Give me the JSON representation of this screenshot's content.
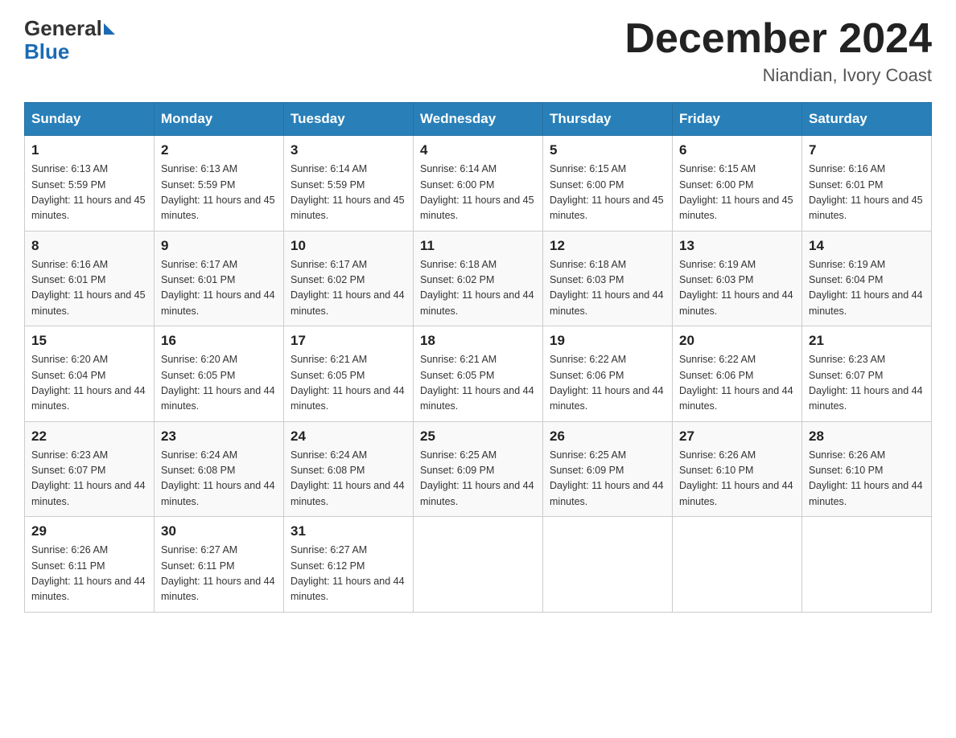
{
  "header": {
    "logo_general": "General",
    "logo_blue": "Blue",
    "month_title": "December 2024",
    "location": "Niandian, Ivory Coast"
  },
  "weekdays": [
    "Sunday",
    "Monday",
    "Tuesday",
    "Wednesday",
    "Thursday",
    "Friday",
    "Saturday"
  ],
  "weeks": [
    [
      {
        "day": "1",
        "sunrise": "6:13 AM",
        "sunset": "5:59 PM",
        "daylight": "11 hours and 45 minutes."
      },
      {
        "day": "2",
        "sunrise": "6:13 AM",
        "sunset": "5:59 PM",
        "daylight": "11 hours and 45 minutes."
      },
      {
        "day": "3",
        "sunrise": "6:14 AM",
        "sunset": "5:59 PM",
        "daylight": "11 hours and 45 minutes."
      },
      {
        "day": "4",
        "sunrise": "6:14 AM",
        "sunset": "6:00 PM",
        "daylight": "11 hours and 45 minutes."
      },
      {
        "day": "5",
        "sunrise": "6:15 AM",
        "sunset": "6:00 PM",
        "daylight": "11 hours and 45 minutes."
      },
      {
        "day": "6",
        "sunrise": "6:15 AM",
        "sunset": "6:00 PM",
        "daylight": "11 hours and 45 minutes."
      },
      {
        "day": "7",
        "sunrise": "6:16 AM",
        "sunset": "6:01 PM",
        "daylight": "11 hours and 45 minutes."
      }
    ],
    [
      {
        "day": "8",
        "sunrise": "6:16 AM",
        "sunset": "6:01 PM",
        "daylight": "11 hours and 45 minutes."
      },
      {
        "day": "9",
        "sunrise": "6:17 AM",
        "sunset": "6:01 PM",
        "daylight": "11 hours and 44 minutes."
      },
      {
        "day": "10",
        "sunrise": "6:17 AM",
        "sunset": "6:02 PM",
        "daylight": "11 hours and 44 minutes."
      },
      {
        "day": "11",
        "sunrise": "6:18 AM",
        "sunset": "6:02 PM",
        "daylight": "11 hours and 44 minutes."
      },
      {
        "day": "12",
        "sunrise": "6:18 AM",
        "sunset": "6:03 PM",
        "daylight": "11 hours and 44 minutes."
      },
      {
        "day": "13",
        "sunrise": "6:19 AM",
        "sunset": "6:03 PM",
        "daylight": "11 hours and 44 minutes."
      },
      {
        "day": "14",
        "sunrise": "6:19 AM",
        "sunset": "6:04 PM",
        "daylight": "11 hours and 44 minutes."
      }
    ],
    [
      {
        "day": "15",
        "sunrise": "6:20 AM",
        "sunset": "6:04 PM",
        "daylight": "11 hours and 44 minutes."
      },
      {
        "day": "16",
        "sunrise": "6:20 AM",
        "sunset": "6:05 PM",
        "daylight": "11 hours and 44 minutes."
      },
      {
        "day": "17",
        "sunrise": "6:21 AM",
        "sunset": "6:05 PM",
        "daylight": "11 hours and 44 minutes."
      },
      {
        "day": "18",
        "sunrise": "6:21 AM",
        "sunset": "6:05 PM",
        "daylight": "11 hours and 44 minutes."
      },
      {
        "day": "19",
        "sunrise": "6:22 AM",
        "sunset": "6:06 PM",
        "daylight": "11 hours and 44 minutes."
      },
      {
        "day": "20",
        "sunrise": "6:22 AM",
        "sunset": "6:06 PM",
        "daylight": "11 hours and 44 minutes."
      },
      {
        "day": "21",
        "sunrise": "6:23 AM",
        "sunset": "6:07 PM",
        "daylight": "11 hours and 44 minutes."
      }
    ],
    [
      {
        "day": "22",
        "sunrise": "6:23 AM",
        "sunset": "6:07 PM",
        "daylight": "11 hours and 44 minutes."
      },
      {
        "day": "23",
        "sunrise": "6:24 AM",
        "sunset": "6:08 PM",
        "daylight": "11 hours and 44 minutes."
      },
      {
        "day": "24",
        "sunrise": "6:24 AM",
        "sunset": "6:08 PM",
        "daylight": "11 hours and 44 minutes."
      },
      {
        "day": "25",
        "sunrise": "6:25 AM",
        "sunset": "6:09 PM",
        "daylight": "11 hours and 44 minutes."
      },
      {
        "day": "26",
        "sunrise": "6:25 AM",
        "sunset": "6:09 PM",
        "daylight": "11 hours and 44 minutes."
      },
      {
        "day": "27",
        "sunrise": "6:26 AM",
        "sunset": "6:10 PM",
        "daylight": "11 hours and 44 minutes."
      },
      {
        "day": "28",
        "sunrise": "6:26 AM",
        "sunset": "6:10 PM",
        "daylight": "11 hours and 44 minutes."
      }
    ],
    [
      {
        "day": "29",
        "sunrise": "6:26 AM",
        "sunset": "6:11 PM",
        "daylight": "11 hours and 44 minutes."
      },
      {
        "day": "30",
        "sunrise": "6:27 AM",
        "sunset": "6:11 PM",
        "daylight": "11 hours and 44 minutes."
      },
      {
        "day": "31",
        "sunrise": "6:27 AM",
        "sunset": "6:12 PM",
        "daylight": "11 hours and 44 minutes."
      },
      null,
      null,
      null,
      null
    ]
  ]
}
